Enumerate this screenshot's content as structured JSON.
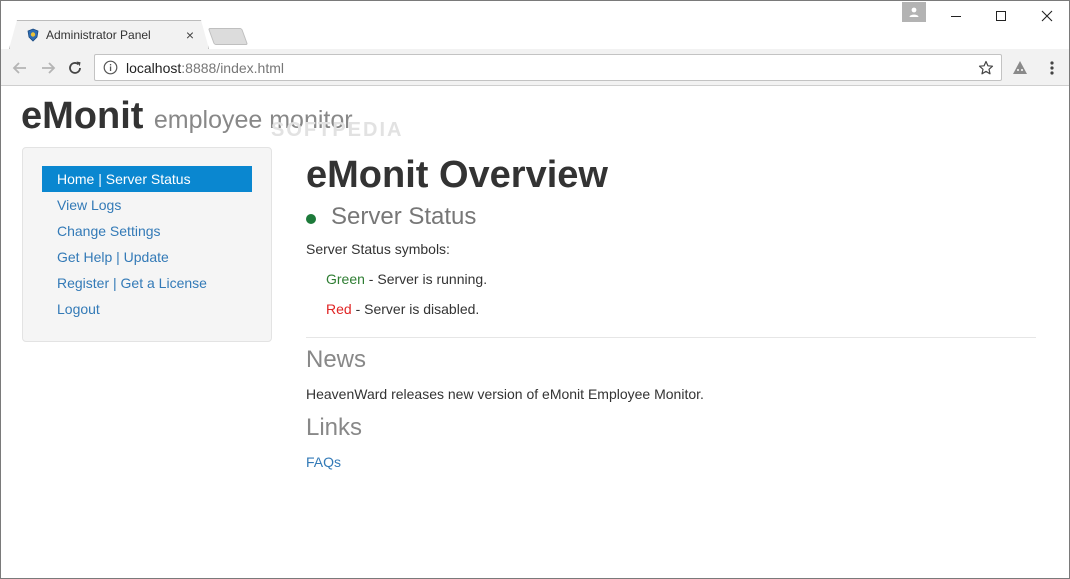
{
  "browser": {
    "tab_title": "Administrator Panel",
    "tab_close": "×",
    "url_host": "localhost",
    "url_path": ":8888/index.html"
  },
  "brand": {
    "name": "eMonit",
    "subtitle": "employee monitor",
    "watermark": "SOFTPEDIA"
  },
  "sidebar": {
    "items": [
      {
        "label": "Home | Server Status",
        "active": true
      },
      {
        "label": "View Logs"
      },
      {
        "label": "Change Settings"
      },
      {
        "label": "Get Help | Update"
      },
      {
        "label": "Register | Get a License"
      },
      {
        "label": "Logout"
      }
    ]
  },
  "main": {
    "title": "eMonit Overview",
    "status_heading": "Server Status",
    "symbols_label": "Server Status symbols:",
    "green_word": "Green",
    "green_text": " - Server is running.",
    "red_word": "Red",
    "red_text": " - Server is disabled.",
    "news_heading": "News",
    "news_text": "HeavenWard releases new version of eMonit Employee Monitor.",
    "links_heading": "Links",
    "faq_link": "FAQs"
  },
  "colors": {
    "active_nav": "#0a87d0",
    "link": "#337ab7",
    "status_green": "#1d7a3a",
    "red": "#e02424"
  }
}
